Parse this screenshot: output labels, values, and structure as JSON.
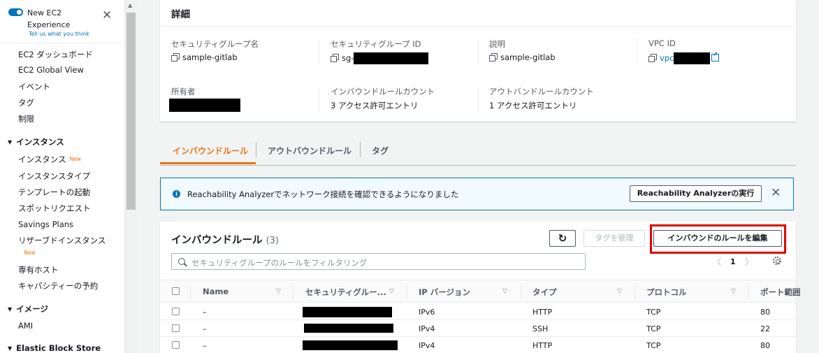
{
  "sidebar": {
    "toggle_title": "New EC2 Experience",
    "feedback": "Tell us what you think",
    "top_items": [
      "EC2 ダッシュボード",
      "EC2 Global View",
      "イベント",
      "タグ",
      "制限"
    ],
    "section_instances": "インスタンス",
    "instance_items": [
      "インスタンス",
      "インスタンスタイプ",
      "テンプレートの起動",
      "スポットリクエスト",
      "Savings Plans",
      "リザーブドインスタンス",
      "専有ホスト",
      "キャパシティーの予約"
    ],
    "new_badge": "New",
    "section_images": "イメージ",
    "image_items": [
      "AMI"
    ],
    "section_ebs": "Elastic Block Store"
  },
  "details": {
    "title": "詳細",
    "sg_name_label": "セキュリティグループ名",
    "sg_name_value": "sample-gitlab",
    "sg_id_label": "セキュリティグループ ID",
    "sg_id_prefix": "sg-",
    "description_label": "説明",
    "description_value": "sample-gitlab",
    "vpc_label": "VPC ID",
    "vpc_prefix": "vpc",
    "owner_label": "所有者",
    "inbound_count_label": "インバウンドルールカウント",
    "inbound_count_value": "3 アクセス許可エントリ",
    "outbound_count_label": "アウトバンドルールカウント",
    "outbound_count_value": "1 アクセス許可エントリ"
  },
  "tabs": [
    "インバウンドルール",
    "アウトバウンドルール",
    "タグ"
  ],
  "banner": {
    "text": "Reachability Analyzerでネットワーク接続を確認できるようになりました",
    "button": "Reachability Analyzerの実行"
  },
  "rules": {
    "title": "インバウンドルール",
    "count": "(3)",
    "manage_tags": "タグを管理",
    "edit_button": "インバウンドのルールを編集",
    "filter_placeholder": "セキュリティグループのルールをフィルタリング",
    "page": "1",
    "columns": [
      "Name",
      "セキュリティグルー...",
      "IP バージョン",
      "タイプ",
      "プロトコル",
      "ポート範囲"
    ],
    "rows": [
      {
        "name": "–",
        "ip": "IPv6",
        "type": "HTTP",
        "protocol": "TCP",
        "port": "80"
      },
      {
        "name": "–",
        "ip": "IPv4",
        "type": "SSH",
        "protocol": "TCP",
        "port": "22"
      },
      {
        "name": "–",
        "ip": "IPv4",
        "type": "HTTP",
        "protocol": "TCP",
        "port": "80"
      }
    ]
  }
}
